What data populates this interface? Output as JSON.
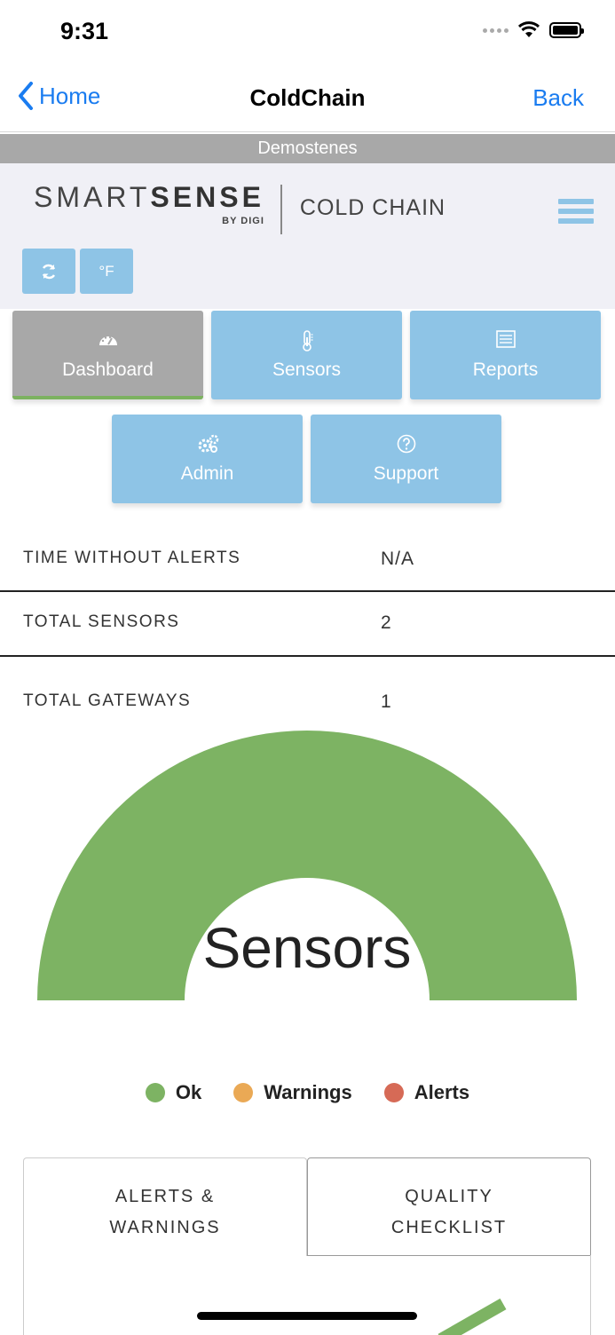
{
  "status_bar": {
    "time": "9:31"
  },
  "navbar": {
    "back_label": "Home",
    "title": "ColdChain",
    "right_label": "Back"
  },
  "account": {
    "name": "Demostenes"
  },
  "header": {
    "logo": {
      "smart": "SMART",
      "sense": "SENSE",
      "by": "BY DIGI",
      "product": "COLD CHAIN"
    },
    "unit_button": "°F"
  },
  "tiles": [
    {
      "label": "Dashboard",
      "icon": "dashboard-gauge-icon",
      "active": true
    },
    {
      "label": "Sensors",
      "icon": "thermometer-icon"
    },
    {
      "label": "Reports",
      "icon": "report-list-icon"
    },
    {
      "label": "Admin",
      "icon": "gears-icon"
    },
    {
      "label": "Support",
      "icon": "question-circle-icon"
    }
  ],
  "stats": [
    {
      "label": "TIME WITHOUT ALERTS",
      "value": "N/A"
    },
    {
      "label": "TOTAL SENSORS",
      "value": "2"
    },
    {
      "label": "TOTAL GATEWAYS",
      "value": "1"
    }
  ],
  "chart_data": {
    "type": "pie",
    "subtype": "half-donut",
    "title": "Sensors",
    "categories": [
      "Ok",
      "Warnings",
      "Alerts"
    ],
    "values": [
      2,
      0,
      0
    ],
    "colors": [
      "#7db363",
      "#eaa955",
      "#d66a56"
    ],
    "legend": "bottom"
  },
  "tabs": [
    {
      "label_line1": "ALERTS &",
      "label_line2": "WARNINGS",
      "active": true
    },
    {
      "label_line1": "QUALITY",
      "label_line2": "CHECKLIST",
      "active": false
    }
  ],
  "colors": {
    "accent": "#1a7cf0",
    "tile": "#8ec4e6",
    "tile_active": "#a8a8a8",
    "ok": "#7db363"
  }
}
